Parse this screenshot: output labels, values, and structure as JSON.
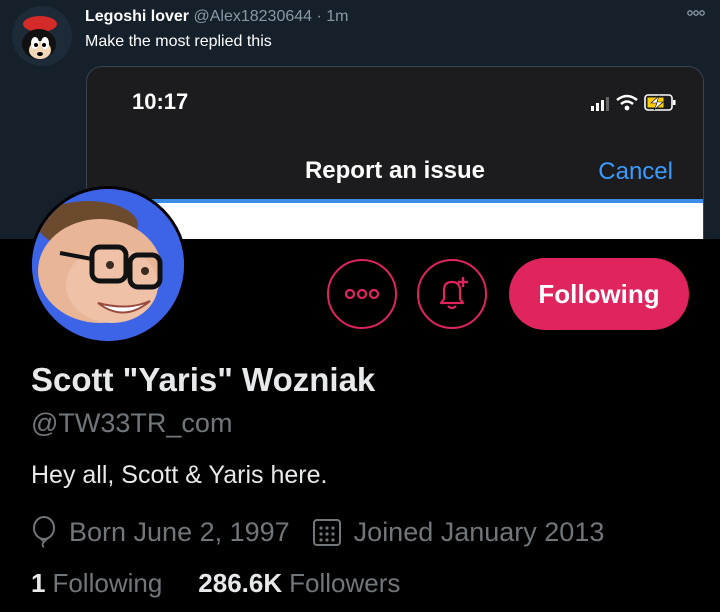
{
  "banner": {
    "tweet": {
      "author_name": "Legoshi lover",
      "author_handle": "@Alex18230644",
      "separator": "·",
      "time": "1m",
      "text": "Make the most replied this"
    },
    "embedded_screenshot": {
      "phone_time": "10:17",
      "sheet_title": "Report an issue",
      "cancel_label": "Cancel",
      "cancel_color": "#3a9bff"
    }
  },
  "profile": {
    "display_name": "Scott \"Yaris\" Wozniak",
    "username": "@TW33TR_com",
    "bio": "Hey all, Scott & Yaris here.",
    "birthday": "Born June 2, 1997",
    "joined": "Joined January 2013",
    "following_count": "1",
    "following_label": "Following",
    "followers_count": "286.6K",
    "followers_label": "Followers",
    "avatar_background": "#3d63e6"
  },
  "actions": {
    "more_icon": "more-options-icon",
    "notify_icon": "bell-plus-icon",
    "following_button_label": "Following",
    "accent_color": "#e0245e"
  }
}
